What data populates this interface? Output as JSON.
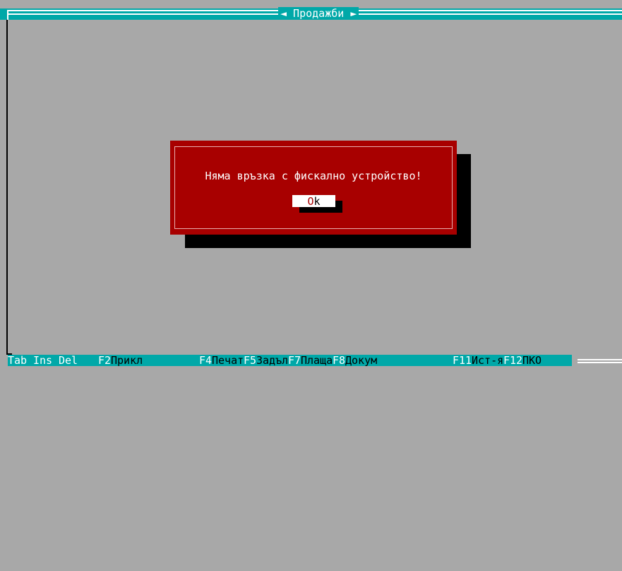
{
  "window": {
    "title": "◄ Продажби ►"
  },
  "dialog": {
    "message": "Няма връзка с фискално устройство!",
    "ok_hotkey": "O",
    "ok_rest": "k"
  },
  "statusbar": {
    "tab": "Tab",
    "ins": "Ins",
    "del": "Del",
    "f2_key": "F2",
    "f2_label": "Прикл",
    "f4_key": "F4",
    "f4_label": "Печат",
    "f5_key": "F5",
    "f5_label": "Задъл",
    "f7_key": "F7",
    "f7_label": "Плаща",
    "f8_key": "F8",
    "f8_label": "Докум",
    "f11_key": "F11",
    "f11_label": "Ист-я",
    "f12_key": "F12",
    "f12_label": "ПКО"
  },
  "colors": {
    "desktop": "#a8a8a8",
    "bar": "#00a8a8",
    "dialog": "#a80000",
    "shadow": "#000000"
  }
}
